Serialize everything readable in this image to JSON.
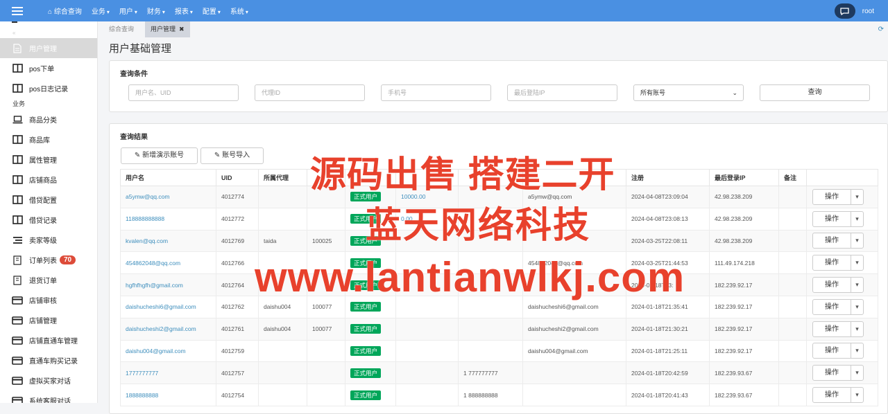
{
  "topnav": [
    {
      "label": "综合查询",
      "icon": "home-icon",
      "caret": false
    },
    {
      "label": "业务",
      "caret": true
    },
    {
      "label": "用户",
      "caret": true
    },
    {
      "label": "财务",
      "caret": true
    },
    {
      "label": "报表",
      "caret": true
    },
    {
      "label": "配置",
      "caret": true
    },
    {
      "label": "系统",
      "caret": true
    }
  ],
  "user": {
    "name": "root"
  },
  "sidebar": [
    {
      "type": "item",
      "label": "用户管理",
      "icon": "document-icon",
      "active": true
    },
    {
      "type": "item",
      "label": "pos下单",
      "icon": "columns-icon"
    },
    {
      "type": "item",
      "label": "pos日志记录",
      "icon": "columns-icon"
    },
    {
      "type": "group",
      "label": "业务"
    },
    {
      "type": "item",
      "label": "商品分类",
      "icon": "laptop-icon"
    },
    {
      "type": "item",
      "label": "商品库",
      "icon": "columns-icon"
    },
    {
      "type": "item",
      "label": "属性管理",
      "icon": "columns-icon"
    },
    {
      "type": "item",
      "label": "店铺商品",
      "icon": "columns-icon"
    },
    {
      "type": "item",
      "label": "借贷配置",
      "icon": "columns-icon"
    },
    {
      "type": "item",
      "label": "借贷记录",
      "icon": "columns-icon"
    },
    {
      "type": "item",
      "label": "卖家等级",
      "icon": "list-icon"
    },
    {
      "type": "item",
      "label": "订单列表",
      "icon": "order-icon",
      "badge": "70"
    },
    {
      "type": "item",
      "label": "退货订单",
      "icon": "order-icon"
    },
    {
      "type": "item",
      "label": "店铺审核",
      "icon": "card-icon"
    },
    {
      "type": "item",
      "label": "店铺管理",
      "icon": "card-icon"
    },
    {
      "type": "item",
      "label": "店铺直通车管理",
      "icon": "card-icon"
    },
    {
      "type": "item",
      "label": "直通车购买记录",
      "icon": "card-icon"
    },
    {
      "type": "item",
      "label": "虚拟买家对话",
      "icon": "card-icon"
    },
    {
      "type": "item",
      "label": "系统客服对话",
      "icon": "card-icon"
    }
  ],
  "tabs": [
    {
      "label": "综合查询",
      "active": false
    },
    {
      "label": "用户管理",
      "active": true,
      "close": "✖"
    }
  ],
  "page_title": "用户基础管理",
  "query": {
    "title": "查询条件",
    "placeholders": [
      "用户名、UID",
      "代理ID",
      "手机号",
      "最后登陆IP"
    ],
    "select_value": "所有账号",
    "search_label": "查询"
  },
  "results": {
    "title": "查询结果",
    "add_demo_label": "新增演示账号",
    "import_label": "账号导入",
    "columns": [
      "用户名",
      "UID",
      "所属代理",
      "",
      "",
      "",
      "",
      "",
      "注册",
      "最后登录IP",
      "备注",
      ""
    ],
    "op_label": "操作",
    "rows": [
      [
        "a5ymw@qq.com",
        "4012774",
        "",
        "",
        "正式用户",
        "10000.00",
        "",
        "a5ymw@qq.com",
        "2024-04-08T23:09:04",
        "42.98.238.209",
        ""
      ],
      [
        "118888888888",
        "4012772",
        "",
        "",
        "正式用户",
        "0.00",
        "",
        "",
        "2024-04-08T23:08:13",
        "42.98.238.209",
        ""
      ],
      [
        "kvalen@qq.com",
        "4012769",
        "taida",
        "100025",
        "正式用户",
        "",
        "",
        "",
        "2024-03-25T22:08:11",
        "42.98.238.209",
        ""
      ],
      [
        "454862048@qq.com",
        "4012766",
        "",
        "",
        "正式用户",
        "",
        "",
        "454862048@qq.com",
        "2024-03-25T21:44:53",
        "111.49.174.218",
        ""
      ],
      [
        "hgfhfhgfh@gmail.com",
        "4012764",
        "",
        "",
        "正式用户",
        "",
        "",
        "",
        "2024-01-18T23:",
        "182.239.92.17",
        ""
      ],
      [
        "daishucheshi6@gmail.com",
        "4012762",
        "daishu004",
        "100077",
        "正式用户",
        "",
        "",
        "daishucheshi6@gmail.com",
        "2024-01-18T21:35:41",
        "182.239.92.17",
        ""
      ],
      [
        "daishucheshi2@gmail.com",
        "4012761",
        "daishu004",
        "100077",
        "正式用户",
        "",
        "",
        "daishucheshi2@gmail.com",
        "2024-01-18T21:30:21",
        "182.239.92.17",
        ""
      ],
      [
        "daishu004@gmail.com",
        "4012759",
        "",
        "",
        "正式用户",
        "",
        "",
        "daishu004@gmail.com",
        "2024-01-18T21:25:11",
        "182.239.92.17",
        ""
      ],
      [
        "1777777777",
        "4012757",
        "",
        "",
        "正式用户",
        "",
        "1 777777777",
        "",
        "2024-01-18T20:42:59",
        "182.239.93.67",
        ""
      ],
      [
        "1888888888",
        "4012754",
        "",
        "",
        "正式用户",
        "",
        "1 888888888",
        "",
        "2024-01-18T20:41:43",
        "182.239.93.67",
        ""
      ]
    ]
  },
  "watermark": {
    "line1": "源码出售 搭建二开",
    "line2": "蓝天网络科技",
    "line3": "www.lantianwlkj.com",
    "color": "#e8412c"
  },
  "colors": {
    "topbar": "#4a90e2",
    "tag": "#00a65a",
    "link": "#3c8dbc"
  }
}
